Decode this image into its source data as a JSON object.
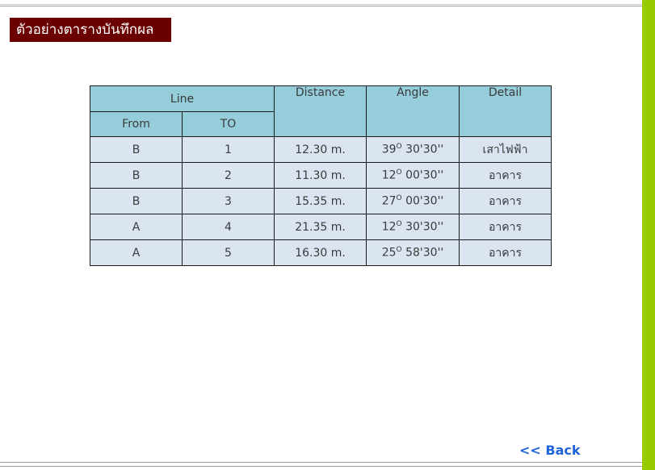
{
  "title": "ตัวอย่างตารางบันทึกผล",
  "table": {
    "headers": {
      "line": "Line",
      "from": "From",
      "to": "TO",
      "distance": "Distance",
      "angle": "Angle",
      "detail": "Detail"
    },
    "rows": [
      {
        "from": "B",
        "to": "1",
        "distance": "12.30 m.",
        "angle_deg": "39",
        "angle_rest": " 30'30''",
        "detail": "เสาไฟฟ้า"
      },
      {
        "from": "B",
        "to": "2",
        "distance": "11.30 m.",
        "angle_deg": "12",
        "angle_rest": " 00'30''",
        "detail": "อาคาร"
      },
      {
        "from": "B",
        "to": "3",
        "distance": "15.35 m.",
        "angle_deg": "27",
        "angle_rest": " 00'30''",
        "detail": "อาคาร"
      },
      {
        "from": "A",
        "to": "4",
        "distance": "21.35 m.",
        "angle_deg": "12",
        "angle_rest": " 30'30''",
        "detail": "อาคาร"
      },
      {
        "from": "A",
        "to": "5",
        "distance": "16.30 m.",
        "angle_deg": "25",
        "angle_rest": " 58'30''",
        "detail": "อาคาร"
      }
    ],
    "degree_symbol": "O"
  },
  "back_link": "<< Back",
  "colors": {
    "title_bg": "#6b0000",
    "header_bg": "#95cddb",
    "cell_bg": "#dbe5f1",
    "accent_bar": "#99cc00",
    "link": "#1e64d8"
  }
}
